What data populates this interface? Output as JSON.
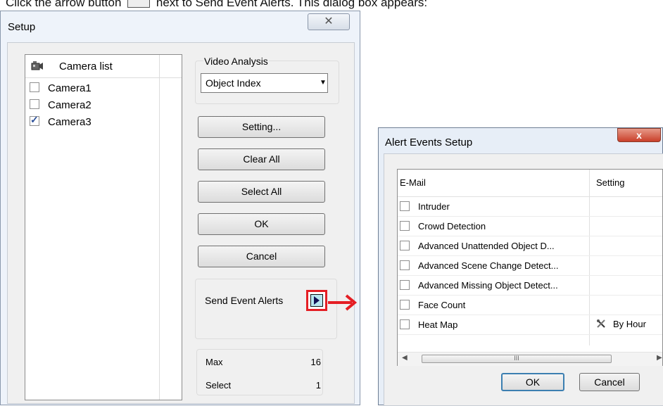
{
  "caption": {
    "before": "Click the arrow button",
    "after": "next to Send Event Alerts. This dialog box appears:"
  },
  "setup": {
    "title": "Setup",
    "close_glyph": "✕",
    "camera_list": {
      "header": "Camera list",
      "icon": "camera-icon",
      "cameras": [
        {
          "name": "Camera1",
          "checked": false
        },
        {
          "name": "Camera2",
          "checked": false
        },
        {
          "name": "Camera3",
          "checked": true
        }
      ]
    },
    "video_analysis": {
      "label": "Video Analysis",
      "selected": "Object Index"
    },
    "buttons": {
      "setting": "Setting...",
      "clear_all": "Clear All",
      "select_all": "Select All",
      "ok": "OK",
      "cancel": "Cancel"
    },
    "send_event_alerts": {
      "label": "Send Event Alerts"
    },
    "stats": {
      "max_label": "Max",
      "max_value": "16",
      "select_label": "Select",
      "select_value": "1"
    }
  },
  "alert_setup": {
    "title": "Alert Events Setup",
    "close_glyph": "x",
    "columns": {
      "email": "E-Mail",
      "setting": "Setting"
    },
    "events": [
      {
        "label": "Intruder",
        "setting": ""
      },
      {
        "label": "Crowd Detection",
        "setting": ""
      },
      {
        "label": "Advanced Unattended Object D...",
        "setting": ""
      },
      {
        "label": "Advanced Scene Change Detect...",
        "setting": ""
      },
      {
        "label": "Advanced Missing Object Detect...",
        "setting": ""
      },
      {
        "label": "Face Count",
        "setting": ""
      },
      {
        "label": "Heat Map",
        "setting": "By Hour"
      }
    ],
    "scroll_thumb": "III",
    "buttons": {
      "ok": "OK",
      "cancel": "Cancel"
    }
  },
  "colors": {
    "highlight": "#e41e24",
    "ok_border": "#3c7fb1"
  }
}
